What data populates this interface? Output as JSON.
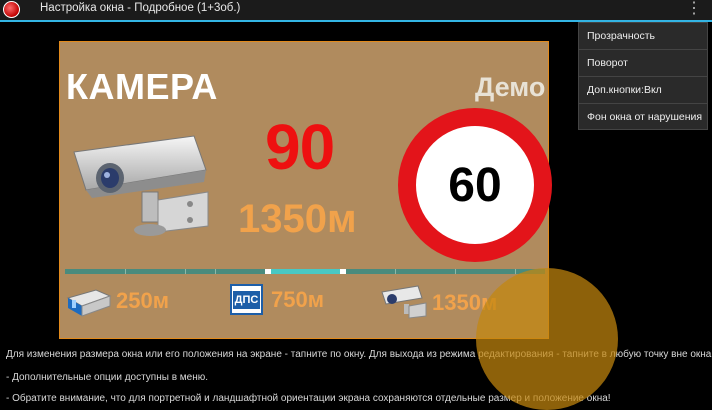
{
  "titlebar": {
    "title": "Настройка окна - Подробное (1+3об.)",
    "overflow_icon": "⋮"
  },
  "overlay": {
    "heading": "КАМЕРА",
    "demo": "Демо",
    "current_speed": "90",
    "distance": "1350м",
    "speed_limit": "60",
    "bottom": [
      {
        "icon": "stationary-radar-icon",
        "distance": "250м"
      },
      {
        "icon": "dps-post-icon",
        "sign_text": "ДПС",
        "distance": "750м"
      },
      {
        "icon": "camera-icon",
        "distance": "1350м"
      }
    ]
  },
  "menu": {
    "items": [
      "Прозрачность",
      "Поворот",
      "Доп.кнопки:Вкл",
      "Фон окна от нарушения"
    ]
  },
  "help": {
    "line1": "Для изменения размера окна или его положения на экране - тапните по окну. Для выхода из режима редактирования - тапните в любую точку вне окна.",
    "line2": "- Дополнительные опции доступны в меню.",
    "line3": "- Обратите внимание, что для портретной и ландшафтной ориентации экрана сохраняются отдельные размер и положение окна!"
  },
  "colors": {
    "accent": "#33b5e5",
    "overlay_bg": "#b08b5e",
    "speed": "#ee1010",
    "distance": "#f1a24b",
    "sign_border": "#e3141a",
    "touch": "#c4860e"
  }
}
